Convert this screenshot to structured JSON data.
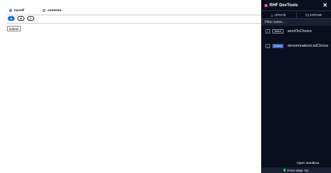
{
  "form": {
    "radios": [
      {
        "label": "myself",
        "checked": true
      },
      {
        "label": "someone",
        "checked": false
      }
    ],
    "pills": [
      {
        "label": "A",
        "active": true
      },
      {
        "label": "B",
        "active": false
      },
      {
        "label": "C",
        "active": false
      }
    ],
    "submit_label": "submit"
  },
  "devtools": {
    "title": "RHF DevTools",
    "close_glyph": "✕",
    "update_label": "UPDATE",
    "update_icon": "△",
    "expand_label": "EXPAND",
    "expand_icon": "[+]",
    "filter_placeholder": "Filter name...",
    "fields": [
      {
        "toggle": "+",
        "badge": "Native",
        "name": "sendToChoice"
      },
      {
        "toggle": "+",
        "badge": "Custom",
        "name": "denominationListChoice"
      }
    ],
    "footer_text": "Form state: On",
    "logo_color": "#ec5990",
    "status_color": "#2ec24a"
  },
  "sandbox_label": "Open Sandbox"
}
